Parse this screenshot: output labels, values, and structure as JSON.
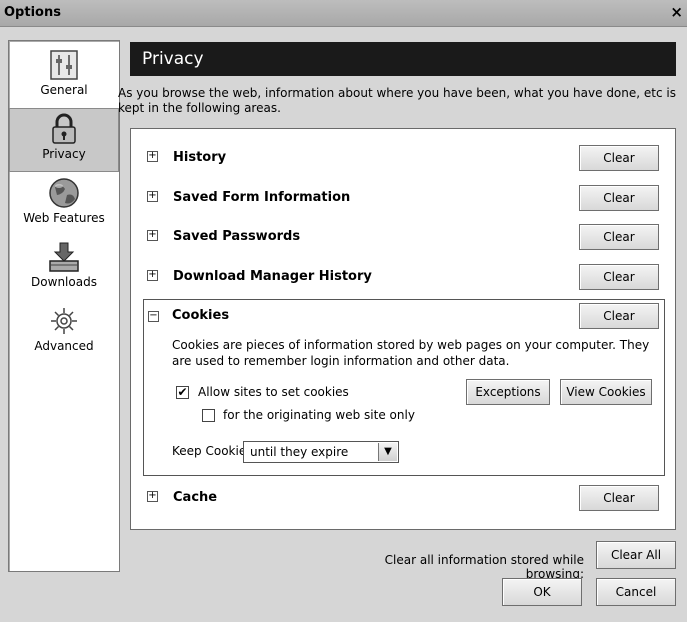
{
  "window": {
    "title": "Options",
    "close_glyph": "×"
  },
  "sidebar": {
    "items": [
      {
        "label": "General",
        "icon": "general-icon"
      },
      {
        "label": "Privacy",
        "icon": "lock-icon",
        "selected": true
      },
      {
        "label": "Web Features",
        "icon": "globe-icon"
      },
      {
        "label": "Downloads",
        "icon": "download-tray-icon"
      },
      {
        "label": "Advanced",
        "icon": "gear-icon"
      }
    ]
  },
  "pane": {
    "title": "Privacy",
    "intro": "As you browse the web, information about where you have been, what you have done, etc is kept in the following areas."
  },
  "sections": [
    {
      "label": "History",
      "expander": "+",
      "button": "Clear"
    },
    {
      "label": "Saved Form Information",
      "expander": "+",
      "button": "Clear"
    },
    {
      "label": "Saved Passwords",
      "expander": "+",
      "button": "Clear"
    },
    {
      "label": "Download Manager History",
      "expander": "+",
      "button": "Clear"
    }
  ],
  "cookies": {
    "label": "Cookies",
    "expander": "−",
    "button": "Clear",
    "description": "Cookies are pieces of information stored by web pages on your computer. They are used to remember login information and other data.",
    "allow_label": "Allow sites to set cookies",
    "allow_checked": true,
    "allow_mark": "✔",
    "originating_label": "for the originating web site only",
    "originating_checked": false,
    "exceptions_button": "Exceptions",
    "view_button": "View Cookies",
    "keep_label": "Keep Cookies:",
    "keep_value": "until they expire",
    "dropdown_glyph": "▼"
  },
  "cache": {
    "label": "Cache",
    "expander": "+",
    "button": "Clear"
  },
  "footer": {
    "clear_all_text": "Clear all information stored while browsing:",
    "clear_all_button": "Clear All",
    "ok_button": "OK",
    "cancel_button": "Cancel"
  }
}
